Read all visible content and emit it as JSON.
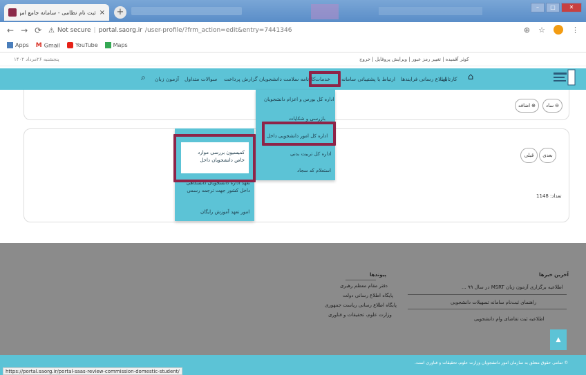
{
  "browser": {
    "tab_title": "ثبت نام نظامی - سامانه جامع امور دانشجو...",
    "new_tab": "+",
    "close_tab": "×",
    "not_secure": "Not secure",
    "domain": "portal.saorg.ir",
    "path": "/user-profile/?frm_action=edit&entry=7441346",
    "bookmarks": [
      "Apps",
      "Gmail",
      "YouTube",
      "Maps"
    ],
    "status_url": "https://portal.saorg.ir/portal-saas-review-commission-domestic-student/"
  },
  "site": {
    "date": "پنجشنبه ۲۶مرداد ۱۴۰۲",
    "user_line": "کوثر آقمیده | تغییر رمز عبور | ویرایش پروفایل | خروج",
    "nav": [
      "کارتابل",
      "اطلاع رسانی فرایندها",
      "ارتباط با پشتیبانی سامانه",
      "خدمات",
      "کارنامه سلامت دانشجویان",
      "گزارش پرداخت",
      "سوالات متداول",
      "آزمون زبان"
    ],
    "menu1": [
      "اداره کل بورس و اعزام دانشجویان",
      "بازرسی و شکایات",
      "اداره کل امور دانشجویی داخل",
      "اداره کل تربیت بدنی",
      "استعلام کد سجاد"
    ],
    "menu2": {
      "top": "کمیسیون بررسی موارد خاص دانشجویان داخل",
      "middle": "تعهد اداره دانشجویان دانشگاهی داخل کشور جهت ترجمه رسمی",
      "bottom": "امور تعهد آموزش رایگان"
    },
    "buttons": {
      "add": "اضافه",
      "ok": "ساد",
      "prev": "قبلی",
      "next": "بعدی"
    },
    "count": "تعداد: 1148"
  },
  "footer": {
    "links_title": "پیوندها",
    "links": [
      "دفتر مقام معظم رهبری",
      "پایگاه اطلاع رسانی دولت",
      "پایگاه اطلاع رسانی ریاست جمهوری",
      "وزارت علوم، تحقیقات و فناوری"
    ],
    "news_title": "آخرین خبرها",
    "news": [
      "اطلاعیه برگزاری آزمون زبان MSRT در سال ۹۹ ...",
      "راهنمای ثبت‌نام سامانه تسهیلات دانشجویی",
      "اطلاعیه ثبت تقاضای وام دانشجویی"
    ],
    "copyright": "© تمامی حقوق متعلق به سازمان امور دانشجویان وزارت علوم، تحقیقات و فناوری است.",
    "up": "▲"
  },
  "colors": {
    "nav": "#5cc3d6",
    "highlight": "#8e2448",
    "footer": "#8b8b8b"
  }
}
